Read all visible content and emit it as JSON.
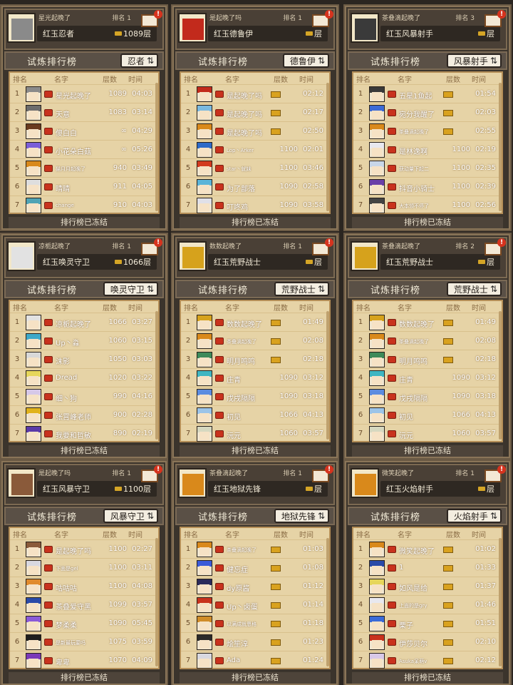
{
  "title_common": "试炼排行榜",
  "footer_common": "排行榜已冻结",
  "columns": {
    "rank": "排名",
    "name": "名字",
    "floors": "层数",
    "time": "时间"
  },
  "panels": [
    {
      "header": {
        "name": "星光起晚了",
        "rank": "排名 1",
        "title": "红玉忍者",
        "floor": "1089层"
      },
      "class": "忍者",
      "rows": [
        {
          "rank": "1",
          "name": "星光起晚了",
          "floor": "1089",
          "time": "04:03",
          "hair": "#8a8a8a"
        },
        {
          "rank": "2",
          "name": "天意",
          "floor": "1083",
          "time": "03:14",
          "hair": "#6c6c6c"
        },
        {
          "rank": "3",
          "name": "傻白白",
          "floor": "∞",
          "time": "04:29",
          "hair": "#6a3b1e"
        },
        {
          "rank": "4",
          "name": "小花朵白菇",
          "floor": "∞",
          "time": "05:26",
          "hair": "#7a5ed8"
        },
        {
          "rank": "5",
          "name": "猫月月起晚了",
          "floor": "940",
          "time": "03:49",
          "hair": "#d9891b"
        },
        {
          "rank": "6",
          "name": "晴晴",
          "floor": "911",
          "time": "04:05",
          "hair": "#dedede"
        },
        {
          "rank": "7",
          "name": "change",
          "floor": "910",
          "time": "04:03",
          "hair": "#4fa3b5"
        }
      ]
    },
    {
      "header": {
        "name": "是起晚了吗",
        "rank": "排名 1",
        "title": "红玉德鲁伊",
        "floor": "层"
      },
      "class": "德鲁伊",
      "rows": [
        {
          "rank": "1",
          "name": "是起晚了吗",
          "floor": "",
          "time": "02:12",
          "hair": "#c22a1c"
        },
        {
          "rank": "2",
          "name": "是起晚了吗",
          "floor": "",
          "time": "02:17",
          "hair": "#7ab9e0"
        },
        {
          "rank": "3",
          "name": "是起晚了吗",
          "floor": "",
          "time": "02:50",
          "hair": "#d9891b"
        },
        {
          "rank": "4",
          "name": "Lop丶Arker",
          "floor": "1100",
          "time": "02:01",
          "hair": "#2d6ac8"
        },
        {
          "rank": "5",
          "name": "star丶就妹",
          "floor": "1100",
          "time": "03:46",
          "hair": "#d23a1f"
        },
        {
          "rank": "6",
          "name": "为了部落",
          "floor": "1090",
          "time": "02:58",
          "hair": "#5bb4d8"
        },
        {
          "rank": "7",
          "name": "叮咚鸡",
          "floor": "1090",
          "time": "03:58",
          "hair": "#e0e0e8"
        }
      ]
    },
    {
      "header": {
        "name": "茶叠滴起晚了",
        "rank": "排名 3",
        "title": "红玉风暴射手",
        "floor": "层"
      },
      "class": "风暴射手",
      "rows": [
        {
          "rank": "1",
          "name": "五星1鱼起",
          "floor": "",
          "time": "01:54",
          "hair": "#3a3a3a"
        },
        {
          "rank": "2",
          "name": "宛分我醒了",
          "floor": "",
          "time": "02:03",
          "hair": "#3c6ad6"
        },
        {
          "rank": "3",
          "name": "茶叠滴起晚了",
          "floor": "",
          "time": "02:55",
          "hair": "#d9891b"
        },
        {
          "rank": "4",
          "name": "是林逸啊",
          "floor": "1100",
          "time": "02:19",
          "hair": "#e8e8ef"
        },
        {
          "rank": "5",
          "name": "获动量下起二",
          "floor": "1100",
          "time": "02:35",
          "hair": "#c8d6e8"
        },
        {
          "rank": "6",
          "name": "抖音小骑士",
          "floor": "1100",
          "time": "02:39",
          "hair": "#6a3fa8"
        },
        {
          "rank": "7",
          "name": "大本领不停了",
          "floor": "1100",
          "time": "02:56",
          "hair": "#444444"
        }
      ]
    },
    {
      "header": {
        "name": "凉栀起晚了",
        "rank": "排名 1",
        "title": "红玉唤灵守卫",
        "floor": "1066层"
      },
      "class": "唤灵守卫",
      "rows": [
        {
          "rank": "1",
          "name": "凉栀起晚了",
          "floor": "1066",
          "time": "03:27",
          "hair": "#e2e2e2"
        },
        {
          "rank": "2",
          "name": "Up丶淼",
          "floor": "1060",
          "time": "03:15",
          "hair": "#3ea9c8"
        },
        {
          "rank": "3",
          "name": "沫影",
          "floor": "1050",
          "time": "03:03",
          "hair": "#d8d8d8"
        },
        {
          "rank": "4",
          "name": "Dread",
          "floor": "1020",
          "time": "03:22",
          "hair": "#e6d65a"
        },
        {
          "rank": "5",
          "name": "细丶狗",
          "floor": "990",
          "time": "04:16",
          "hair": "#d6c8e8"
        },
        {
          "rank": "6",
          "name": "张霄峰老师",
          "floor": "900",
          "time": "02:28",
          "hair": "#e0b21c"
        },
        {
          "rank": "7",
          "name": "我要和哲敏",
          "floor": "890",
          "time": "02:19",
          "hair": "#5a3aa8"
        }
      ]
    },
    {
      "header": {
        "name": "数数起晚了",
        "rank": "排名 1",
        "title": "红玉荒野战士",
        "floor": "层"
      },
      "class": "荒野战士",
      "rows": [
        {
          "rank": "1",
          "name": "数数起晚了",
          "floor": "",
          "time": "01:49",
          "hair": "#d6a21c"
        },
        {
          "rank": "2",
          "name": "茶叠滴起晚了",
          "floor": "",
          "time": "02:08",
          "hair": "#d9891b"
        },
        {
          "rank": "3",
          "name": "明月鸣鸣",
          "floor": "",
          "time": "02:18",
          "hair": "#3d8a5a"
        },
        {
          "rank": "4",
          "name": "庄青",
          "floor": "1090",
          "time": "03:12",
          "hair": "#3fb6c2"
        },
        {
          "rank": "5",
          "name": "戊戌隔隔",
          "floor": "1090",
          "time": "03:18",
          "hair": "#5c8ce0"
        },
        {
          "rank": "6",
          "name": "初见",
          "floor": "1066",
          "time": "04:13",
          "hair": "#9cc4e8"
        },
        {
          "rank": "7",
          "name": "沅元",
          "floor": "1060",
          "time": "03:57",
          "hair": "#d6d8c0"
        }
      ]
    },
    {
      "header": {
        "name": "茶叠滴起晚了",
        "rank": "排名 2",
        "title": "红玉荒野战士",
        "floor": "层"
      },
      "class": "荒野战士",
      "rows": [
        {
          "rank": "1",
          "name": "数数起晚了",
          "floor": "",
          "time": "01:49",
          "hair": "#d6a21c"
        },
        {
          "rank": "2",
          "name": "茶叠滴起晚了",
          "floor": "",
          "time": "02:08",
          "hair": "#d9891b"
        },
        {
          "rank": "3",
          "name": "明月鸣鸣",
          "floor": "",
          "time": "02:18",
          "hair": "#3d8a5a"
        },
        {
          "rank": "4",
          "name": "庄青",
          "floor": "1090",
          "time": "03:12",
          "hair": "#3fb6c2"
        },
        {
          "rank": "5",
          "name": "戊戌隔隔",
          "floor": "1090",
          "time": "03:18",
          "hair": "#5c8ce0"
        },
        {
          "rank": "6",
          "name": "初见",
          "floor": "1066",
          "time": "04:13",
          "hair": "#9cc4e8"
        },
        {
          "rank": "7",
          "name": "沅元",
          "floor": "1060",
          "time": "03:57",
          "hair": "#d6d8c0"
        }
      ]
    },
    {
      "header": {
        "name": "是起晚了吗",
        "rank": "排名 1",
        "title": "红玉风暴守卫",
        "floor": "1100层"
      },
      "class": "风暴守卫",
      "rows": [
        {
          "rank": "1",
          "name": "是起晚了吗",
          "floor": "1100",
          "time": "02:27",
          "hair": "#8a5a3a"
        },
        {
          "rank": "2",
          "name": "下面是gel",
          "floor": "1100",
          "time": "03:11",
          "hair": "#d8d8e0"
        },
        {
          "rank": "3",
          "name": "咕咕咕",
          "floor": "1100",
          "time": "04:08",
          "hair": "#e08a2c"
        },
        {
          "rank": "4",
          "name": "茶叠爱守黑",
          "floor": "1099",
          "time": "03:57",
          "hair": "#2a4aa8"
        },
        {
          "rank": "5",
          "name": "梦柔柔",
          "floor": "1090",
          "time": "05:45",
          "hair": "#8a5ad8"
        },
        {
          "rank": "6",
          "name": "是新最玩要吗",
          "floor": "1075",
          "time": "03:59",
          "hair": "#1e1e1e"
        },
        {
          "rank": "7",
          "name": "卑卑",
          "floor": "1070",
          "time": "04:09",
          "hair": "#7a3ab8"
        }
      ]
    },
    {
      "header": {
        "name": "茶叠滴起晚了",
        "rank": "排名 1",
        "title": "红玉地狱先锋",
        "floor": "层"
      },
      "class": "地狱先锋",
      "rows": [
        {
          "rank": "1",
          "name": "茶叠滴起晚了",
          "floor": "",
          "time": "01:03",
          "hair": "#d9891b"
        },
        {
          "rank": "2",
          "name": "健忘症",
          "floor": "",
          "time": "01:08",
          "hair": "#3a5ad8"
        },
        {
          "rank": "3",
          "name": "dy原酱",
          "floor": "",
          "time": "01:12",
          "hair": "#2a2a5a"
        },
        {
          "rank": "4",
          "name": "Up丶卤蛋",
          "floor": "",
          "time": "01:14",
          "hair": "#c8321d"
        },
        {
          "rank": "5",
          "name": "以满成就恩格",
          "floor": "",
          "time": "01:18",
          "hair": "#d08c28"
        },
        {
          "rank": "6",
          "name": "烩笙淳",
          "floor": "",
          "time": "01:23",
          "hair": "#2a2a2a"
        },
        {
          "rank": "7",
          "name": "Ada",
          "floor": "",
          "time": "01:24",
          "hair": "#d8d8e0"
        }
      ]
    },
    {
      "header": {
        "name": "微笑起晚了",
        "rank": "排名 1",
        "title": "红玉火焰射手",
        "floor": "层"
      },
      "class": "火焰射手",
      "rows": [
        {
          "rank": "1",
          "name": "微笑起晚了",
          "floor": "",
          "time": "01:02",
          "hair": "#d9891b"
        },
        {
          "rank": "2",
          "name": "1",
          "floor": "",
          "time": "01:33",
          "hair": "#2a4aa8"
        },
        {
          "rank": "3",
          "name": "如风是给",
          "floor": "",
          "time": "01:37",
          "hair": "#e6d65a"
        },
        {
          "rank": "4",
          "name": "上面的是gry",
          "floor": "",
          "time": "01:46",
          "hair": "#e8e8ef"
        },
        {
          "rank": "5",
          "name": "栗子",
          "floor": "",
          "time": "01:51",
          "hair": "#3a6ad8"
        },
        {
          "rank": "6",
          "name": "伊莎贝尔",
          "floor": "",
          "time": "02:10",
          "hair": "#c8321d"
        },
        {
          "rank": "7",
          "name": "Asuka呆萌v",
          "floor": "",
          "time": "02:12",
          "hair": "#d8c8e8"
        }
      ]
    }
  ]
}
